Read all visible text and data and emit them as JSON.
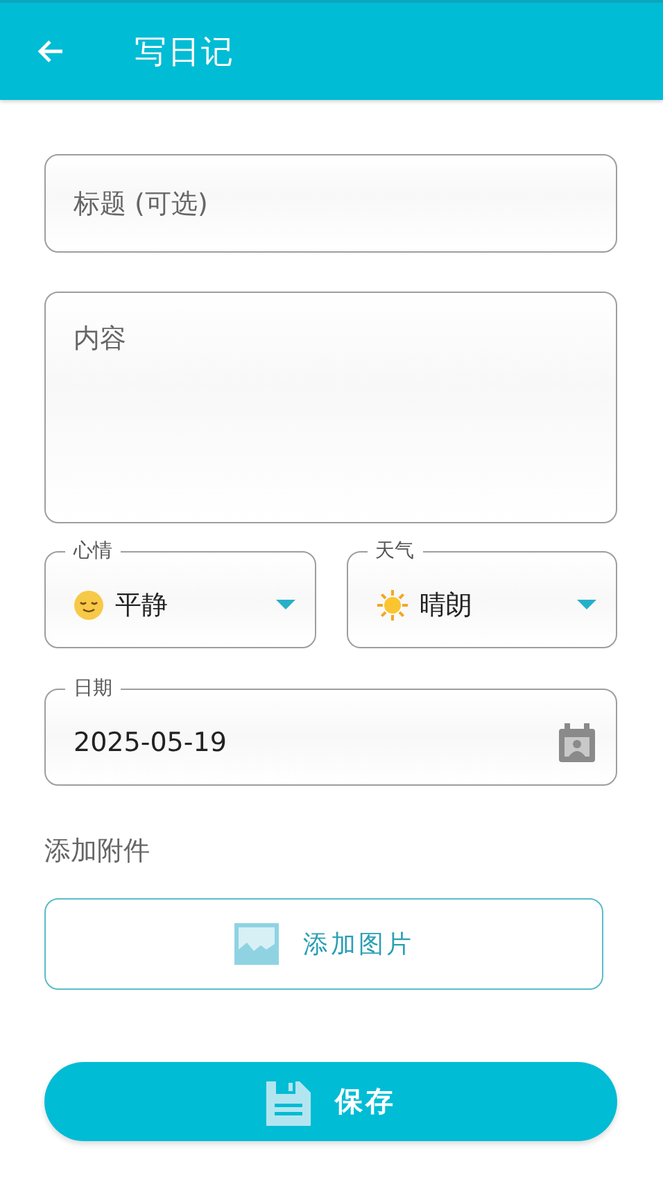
{
  "header": {
    "title": "写日记"
  },
  "title_field": {
    "placeholder": "标题 (可选)"
  },
  "content_field": {
    "placeholder": "内容"
  },
  "selects": [
    {
      "kind": "mood",
      "label": "心情",
      "value": "平静"
    },
    {
      "kind": "weather",
      "label": "天气",
      "value": "晴朗"
    }
  ],
  "date_field": {
    "label": "日期",
    "value": "2025-05-19"
  },
  "attachments": {
    "heading": "添加附件",
    "add_image_button": "添加图片"
  },
  "save_button": "保存"
}
